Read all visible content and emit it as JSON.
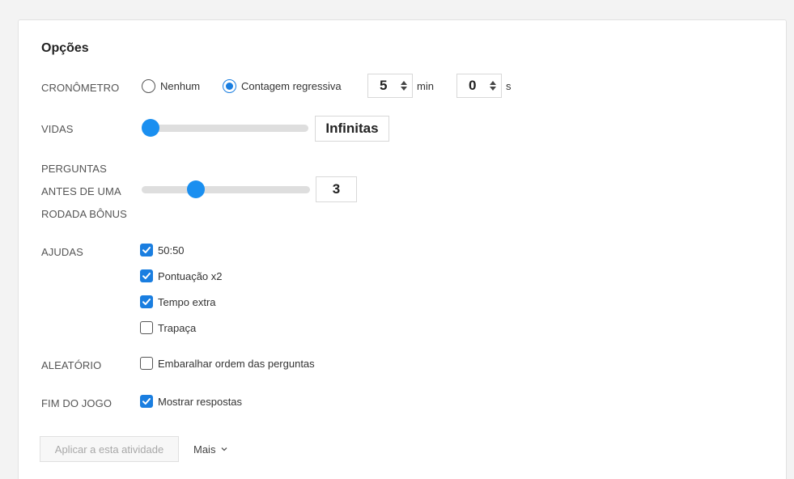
{
  "options": {
    "title": "Opções",
    "timer": {
      "label": "CRONÔMETRO",
      "opt_none": "Nenhum",
      "opt_countdown": "Contagem regressiva",
      "selected": "countdown",
      "minutes": "5",
      "minutes_unit": "min",
      "seconds": "0",
      "seconds_unit": "s"
    },
    "lives": {
      "label": "VIDAS",
      "value": "Infinitas",
      "slider_fraction": 0.0
    },
    "bonus": {
      "label_line1": "PERGUNTAS",
      "label_line2": "ANTES DE UMA",
      "label_line3": "RODADA BÔNUS",
      "value": "3",
      "slider_fraction": 0.3
    },
    "helps": {
      "label": "AJUDAS",
      "items": [
        {
          "label": "50:50",
          "checked": true
        },
        {
          "label": "Pontuação x2",
          "checked": true
        },
        {
          "label": "Tempo extra",
          "checked": true
        },
        {
          "label": "Trapaça",
          "checked": false
        }
      ]
    },
    "random": {
      "label": "ALEATÓRIO",
      "item": {
        "label": "Embaralhar ordem das perguntas",
        "checked": false
      }
    },
    "end": {
      "label": "FIM DO JOGO",
      "item": {
        "label": "Mostrar respostas",
        "checked": true
      }
    },
    "apply_button": "Aplicar a esta atividade",
    "more_button": "Mais"
  },
  "colors": {
    "accent": "#1a7ee0",
    "slider_thumb": "#1a8ff0"
  },
  "icons": {
    "checkmark": "check-icon",
    "more": "chevron-down-icon",
    "spinner": "spinner-arrows-icon"
  }
}
